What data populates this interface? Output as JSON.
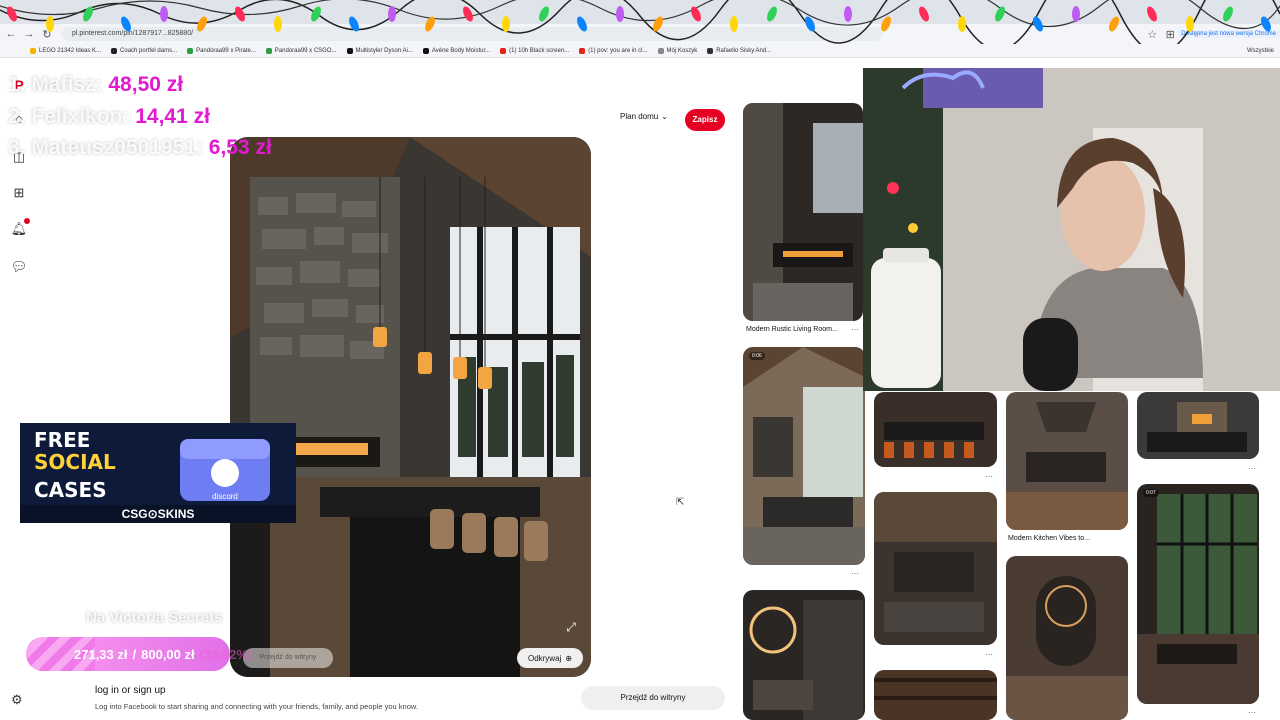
{
  "browser": {
    "url": "pl.pinterest.com/pin/1287917...825880/",
    "bookmarks": [
      {
        "label": "LEGO 21342 Ideas K...",
        "color": "#f2b400"
      },
      {
        "label": "Coach portfel dams...",
        "color": "#222222"
      },
      {
        "label": "Pandoraa99 x Pirate...",
        "color": "#2e9e44"
      },
      {
        "label": "Pandoraa99 x CSGO...",
        "color": "#2e9e44"
      },
      {
        "label": "Multistyler Dyson Ai...",
        "color": "#111111"
      },
      {
        "label": "Avène Body Moistur...",
        "color": "#111111"
      },
      {
        "label": "(1) 10h Black screen...",
        "color": "#e62117"
      },
      {
        "label": "(1) pov: you are in cl...",
        "color": "#e62117"
      },
      {
        "label": "Mój Koszyk",
        "color": "#888888"
      },
      {
        "label": "Rafaello Sisky And...",
        "color": "#333333"
      }
    ],
    "lang_note": "Dostępna jest nowa wersja Chrome",
    "all_bookmarks": "Wszystkie"
  },
  "overlay": {
    "donors": [
      {
        "rank_name": "1. Mafisz:",
        "amount": "48,50 zł"
      },
      {
        "rank_name": "2. Felixikon:",
        "amount": "14,41 zł"
      },
      {
        "rank_name": "3. Mateusz0501951:",
        "amount": "6,53 zł"
      }
    ],
    "promo": {
      "line1": "FREE",
      "line2": "SOCIAL",
      "line3": "CASES",
      "brand": "CSG⊙SKINS",
      "case_label": "discord"
    },
    "goal": {
      "label": "Na Victoria Secrets",
      "current": "271,33 zł",
      "separator": "/",
      "target": "800,00 zł",
      "percent": "(33,92%)",
      "progress": 0.3392
    }
  },
  "pin": {
    "board_select": "Plan domu",
    "save_label": "Zapisz",
    "explore_label": "Odkrywaj",
    "visit_ghost": "Przejdź do witryny",
    "login_title": "log in or sign up",
    "login_sub": "Log into Facebook to start sharing and connecting with your friends, family, and people you know.",
    "visit_label": "Przejdź do witryny"
  },
  "feed": {
    "captions": [
      "Modern Rustic Living Room...",
      "Modern Kitchen Vibes to..."
    ],
    "badges": [
      "0:06",
      "0:07"
    ]
  }
}
